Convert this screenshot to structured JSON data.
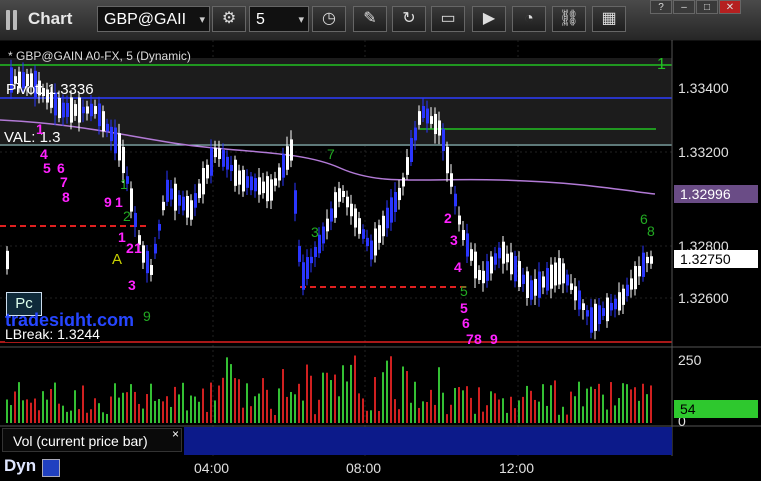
{
  "window": {
    "title": "Chart",
    "symbol": "GBP@GAII",
    "interval": "5",
    "controls": [
      "?",
      "–",
      "□",
      "✕"
    ]
  },
  "chart": {
    "header": "* GBP@GAIN A0-FX, 5 (Dynamic)",
    "price_labels": [
      "1.33400",
      "1.33200",
      "1.32800",
      "1.32600"
    ],
    "current_price_label": "1.32750",
    "secondary_price_label": "1.32996",
    "top_marker": "1",
    "pivot_label": "Pivot: 1.3336",
    "val_label": "VAL: 1.3",
    "lbreak_label": "LBreak: 1.3244",
    "annotation_A": "A",
    "pc_label": "Pc",
    "watermark": "tradesight.com",
    "time_labels": [
      "04:00",
      "08:00",
      "12:00"
    ],
    "volume_axis": [
      "250",
      "0"
    ],
    "volume_value": "54",
    "volume_panel_label": "Vol (current price bar)",
    "volume_close": "×",
    "bottom_label": "Dyn",
    "colors": {
      "background": "#000000",
      "up_bar": "#ffffff",
      "down_bar": "#2a36ff",
      "pivot_line": "#2c3dff",
      "green_line": "#22c022",
      "red_line": "#e02020",
      "purple_line": "#b27ad6",
      "magenta_text": "#ff22ff",
      "green_text": "#22aa22",
      "vol_green": "#34c034",
      "vol_red": "#d02020"
    },
    "magenta_counts": [
      "1",
      "4",
      "5",
      "6",
      "7",
      "8",
      "9",
      "1",
      "1",
      "2",
      "1",
      "3",
      "2",
      "3",
      "4",
      "5",
      "6",
      "7",
      "8",
      "9"
    ],
    "green_counts": [
      "1",
      "2",
      "3",
      "7",
      "8",
      "6",
      "9",
      "5"
    ]
  }
}
